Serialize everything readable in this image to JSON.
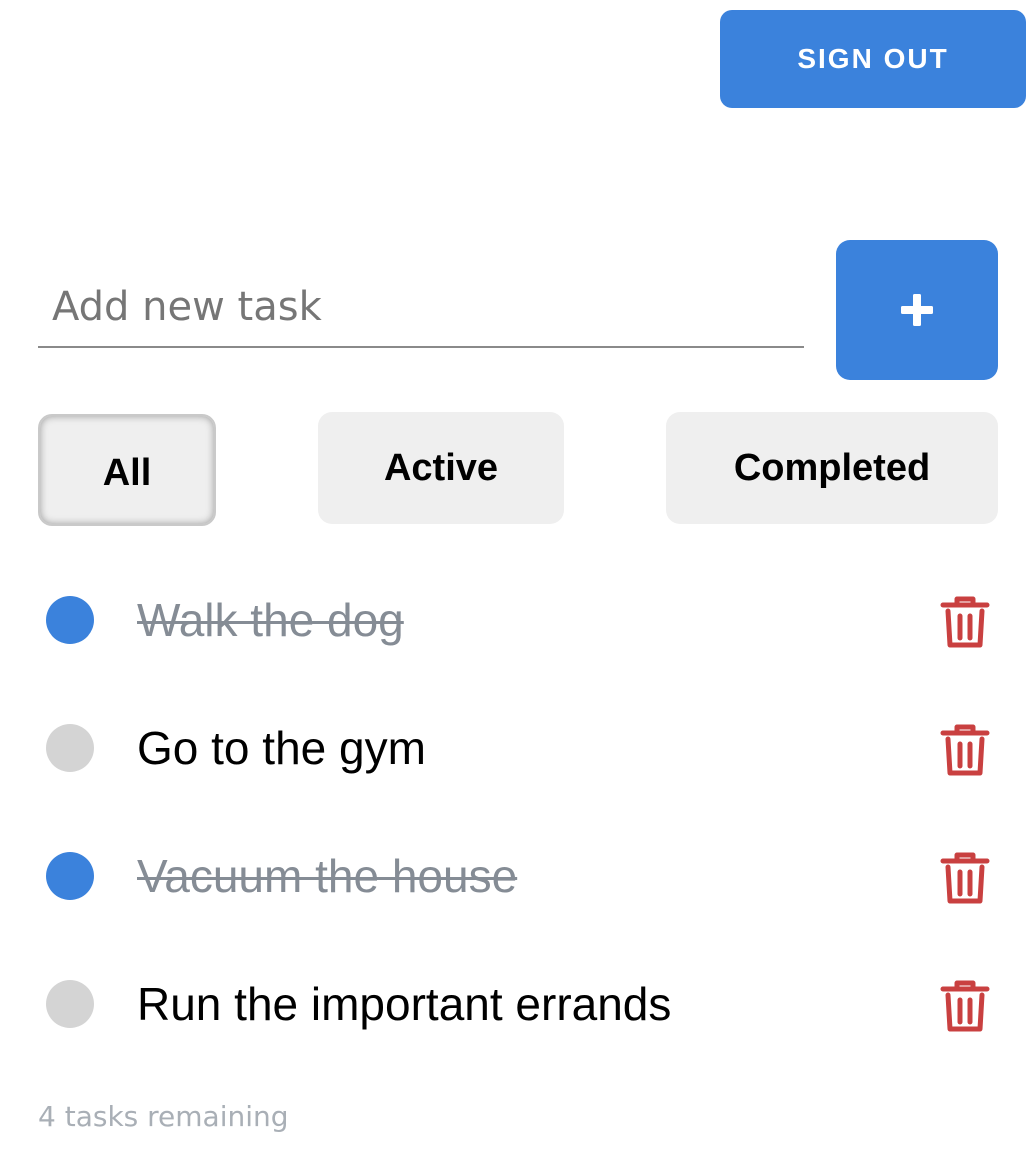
{
  "header": {
    "sign_out_label": "SIGN OUT"
  },
  "composer": {
    "placeholder": "Add new task",
    "value": "",
    "add_icon": "plus-icon"
  },
  "filters": {
    "selected": "All",
    "all_label": "All",
    "active_label": "Active",
    "completed_label": "Completed"
  },
  "tasks": [
    {
      "text": "Walk the dog",
      "completed": true
    },
    {
      "text": "Go to the gym",
      "completed": false
    },
    {
      "text": "Vacuum the house",
      "completed": true
    },
    {
      "text": "Run the important errands",
      "completed": false
    }
  ],
  "footer": {
    "remaining_text": "4 tasks remaining"
  },
  "colors": {
    "accent": "#3b82dc",
    "delete": "#c94040",
    "unchecked": "#d4d4d4",
    "completed_text": "#858c95"
  },
  "icons": {
    "delete": "trash-icon",
    "add": "plus-icon"
  }
}
